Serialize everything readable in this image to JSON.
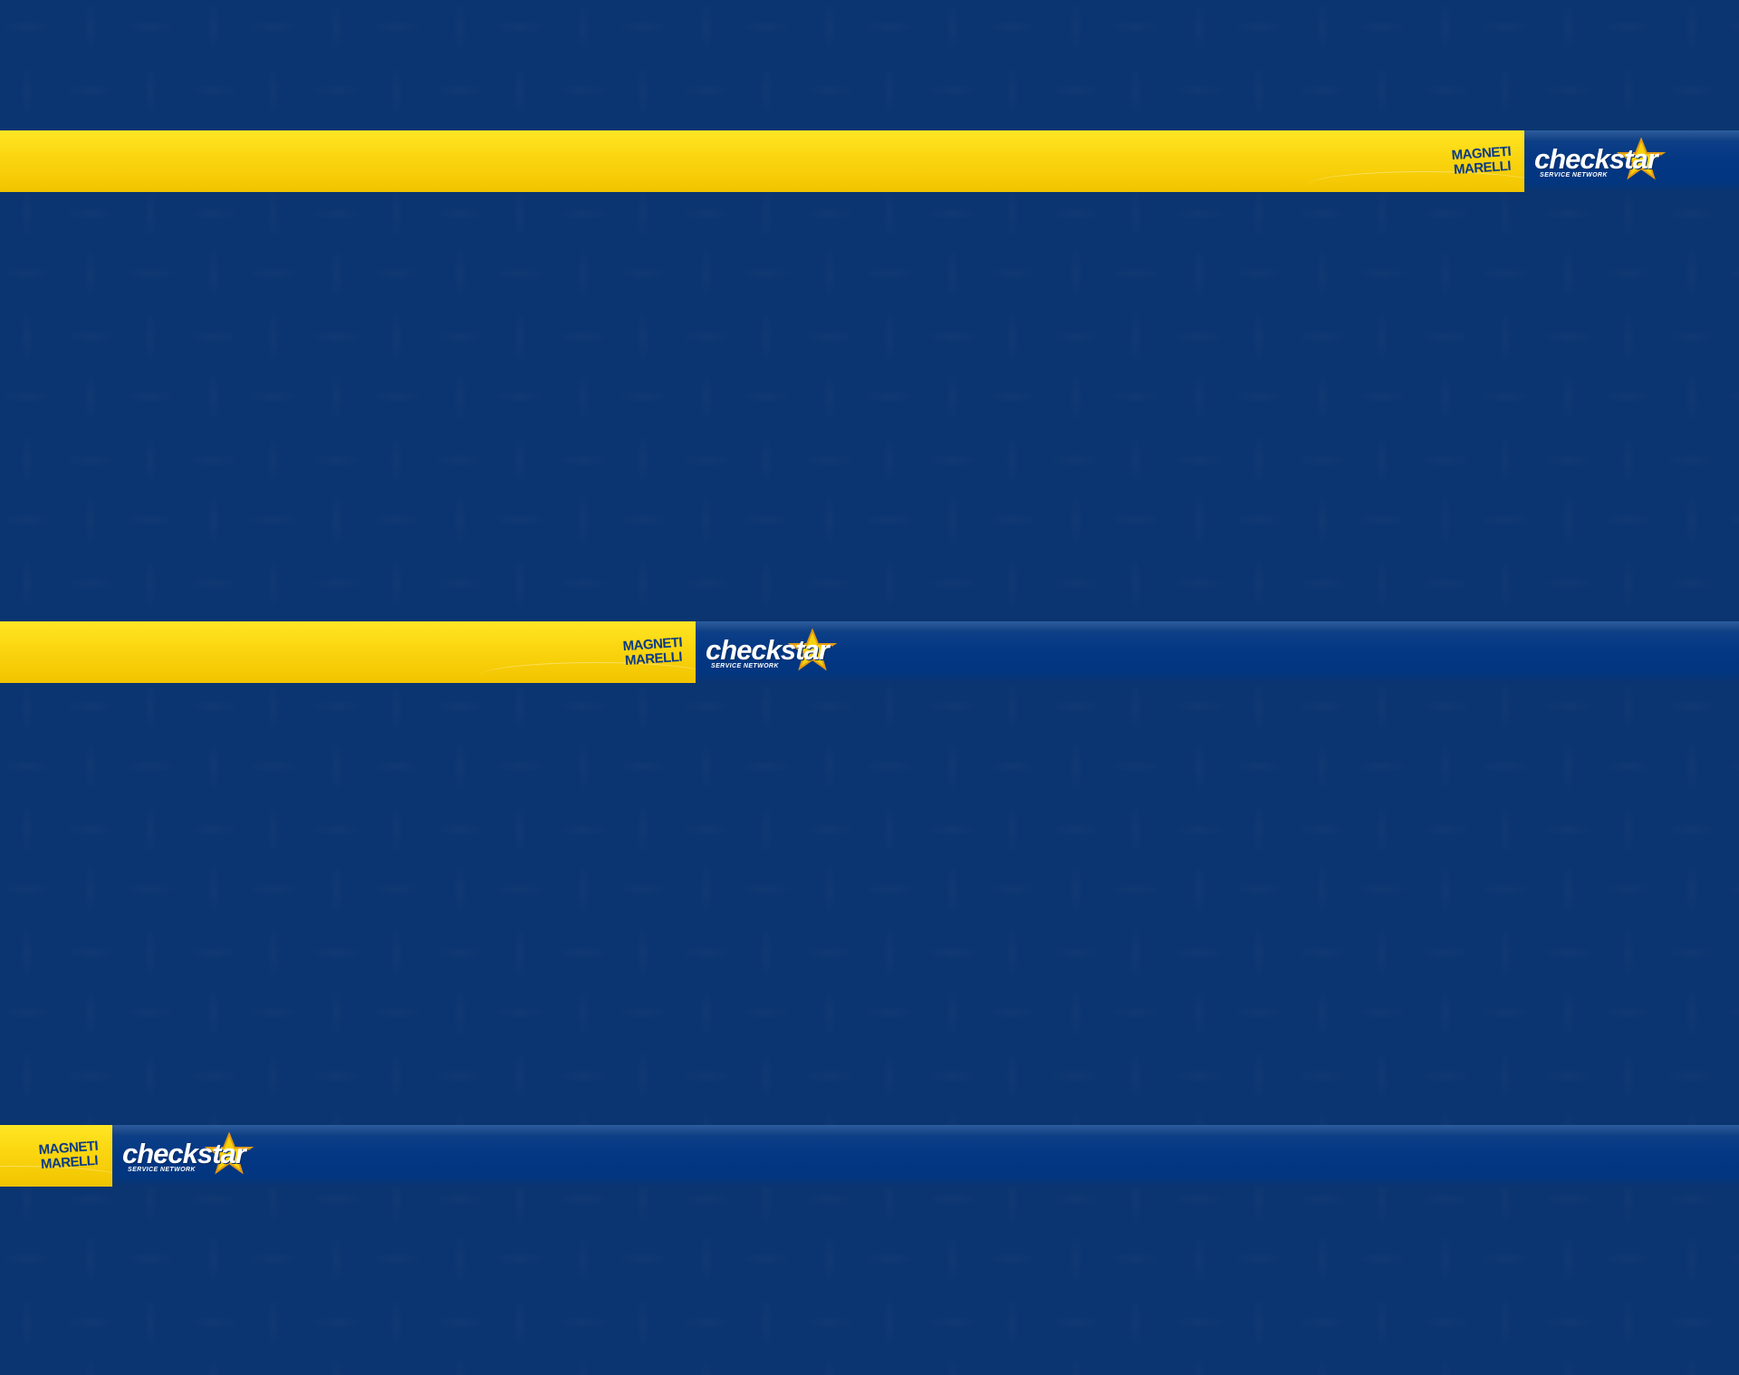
{
  "brand": {
    "magneti_line1": "MAGNETI",
    "magneti_line2": "MARELLI",
    "checkstar": "checkstar",
    "tagline": "SERVICE NETWORK"
  },
  "colors": {
    "background": "#0b3570",
    "yellow": "#f8cf0a",
    "blue_band": "#033784"
  },
  "icons": [
    "star-icon"
  ]
}
